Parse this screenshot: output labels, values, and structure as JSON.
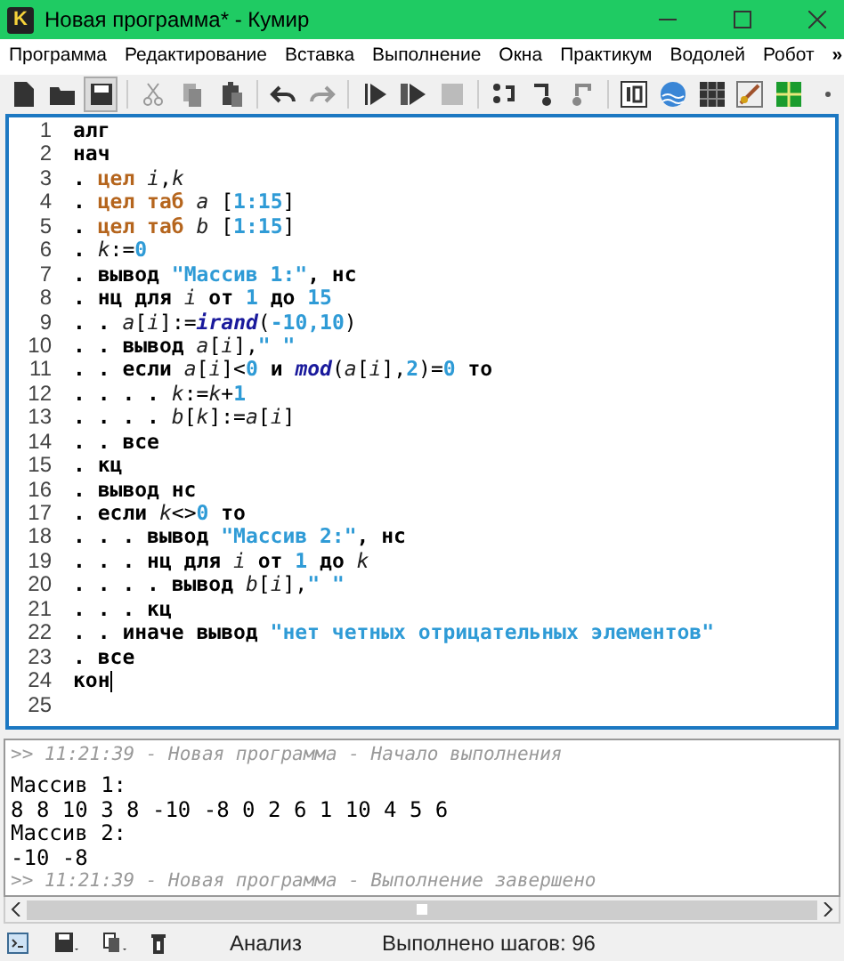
{
  "window": {
    "logo": "K",
    "title": "Новая программа* - Кумир"
  },
  "menu": [
    "Программа",
    "Редактирование",
    "Вставка",
    "Выполнение",
    "Окна",
    "Практикум",
    "Водолей",
    "Робот"
  ],
  "menu_overflow": "»",
  "editor": {
    "lines": [
      {
        "number": "1",
        "tokens": [
          {
            "kind": "kw",
            "text": "алг"
          }
        ]
      },
      {
        "number": "2",
        "tokens": [
          {
            "kind": "kw",
            "text": "нач"
          }
        ]
      },
      {
        "number": "3",
        "tokens": [
          {
            "kind": "kw",
            "text": ". "
          },
          {
            "kind": "type",
            "text": "цел "
          },
          {
            "kind": "var",
            "text": "i"
          },
          {
            "kind": "op",
            "text": ","
          },
          {
            "kind": "var",
            "text": "k"
          }
        ]
      },
      {
        "number": "4",
        "tokens": [
          {
            "kind": "kw",
            "text": ". "
          },
          {
            "kind": "type",
            "text": "цел таб "
          },
          {
            "kind": "var",
            "text": "a"
          },
          {
            "kind": "op",
            "text": " ["
          },
          {
            "kind": "num",
            "text": "1:15"
          },
          {
            "kind": "op",
            "text": "]"
          }
        ]
      },
      {
        "number": "5",
        "tokens": [
          {
            "kind": "kw",
            "text": ". "
          },
          {
            "kind": "type",
            "text": "цел таб "
          },
          {
            "kind": "var",
            "text": "b"
          },
          {
            "kind": "op",
            "text": " ["
          },
          {
            "kind": "num",
            "text": "1:15"
          },
          {
            "kind": "op",
            "text": "]"
          }
        ]
      },
      {
        "number": "6",
        "tokens": [
          {
            "kind": "kw",
            "text": ". "
          },
          {
            "kind": "var",
            "text": "k"
          },
          {
            "kind": "op",
            "text": ":="
          },
          {
            "kind": "num",
            "text": "0"
          }
        ]
      },
      {
        "number": "7",
        "tokens": [
          {
            "kind": "kw",
            "text": ". вывод "
          },
          {
            "kind": "str",
            "text": "\"Массив 1:\""
          },
          {
            "kind": "kw",
            "text": ", нс"
          }
        ]
      },
      {
        "number": "8",
        "tokens": [
          {
            "kind": "kw",
            "text": ". нц для "
          },
          {
            "kind": "var",
            "text": "i"
          },
          {
            "kind": "kw",
            "text": " от "
          },
          {
            "kind": "num",
            "text": "1"
          },
          {
            "kind": "kw",
            "text": " до "
          },
          {
            "kind": "num",
            "text": "15"
          }
        ]
      },
      {
        "number": "9",
        "tokens": [
          {
            "kind": "kw",
            "text": ". . "
          },
          {
            "kind": "var",
            "text": "a"
          },
          {
            "kind": "op",
            "text": "["
          },
          {
            "kind": "var",
            "text": "i"
          },
          {
            "kind": "op",
            "text": "]:="
          },
          {
            "kind": "func",
            "text": "irand"
          },
          {
            "kind": "op",
            "text": "("
          },
          {
            "kind": "num",
            "text": "-10,10"
          },
          {
            "kind": "op",
            "text": ")"
          }
        ]
      },
      {
        "number": "10",
        "tokens": [
          {
            "kind": "kw",
            "text": ". . вывод "
          },
          {
            "kind": "var",
            "text": "a"
          },
          {
            "kind": "op",
            "text": "["
          },
          {
            "kind": "var",
            "text": "i"
          },
          {
            "kind": "op",
            "text": "],"
          },
          {
            "kind": "str",
            "text": "\" \""
          }
        ]
      },
      {
        "number": "11",
        "tokens": [
          {
            "kind": "kw",
            "text": ". . если "
          },
          {
            "kind": "var",
            "text": "a"
          },
          {
            "kind": "op",
            "text": "["
          },
          {
            "kind": "var",
            "text": "i"
          },
          {
            "kind": "op",
            "text": "]<"
          },
          {
            "kind": "num",
            "text": "0"
          },
          {
            "kind": "kw",
            "text": " и "
          },
          {
            "kind": "func",
            "text": "mod"
          },
          {
            "kind": "op",
            "text": "("
          },
          {
            "kind": "var",
            "text": "a"
          },
          {
            "kind": "op",
            "text": "["
          },
          {
            "kind": "var",
            "text": "i"
          },
          {
            "kind": "op",
            "text": "],"
          },
          {
            "kind": "num",
            "text": "2"
          },
          {
            "kind": "op",
            "text": ")="
          },
          {
            "kind": "num",
            "text": "0"
          },
          {
            "kind": "kw",
            "text": " то"
          }
        ]
      },
      {
        "number": "12",
        "tokens": [
          {
            "kind": "kw",
            "text": ". . . . "
          },
          {
            "kind": "var",
            "text": "k"
          },
          {
            "kind": "op",
            "text": ":="
          },
          {
            "kind": "var",
            "text": "k"
          },
          {
            "kind": "op",
            "text": "+"
          },
          {
            "kind": "num",
            "text": "1"
          }
        ]
      },
      {
        "number": "13",
        "tokens": [
          {
            "kind": "kw",
            "text": ". . . . "
          },
          {
            "kind": "var",
            "text": "b"
          },
          {
            "kind": "op",
            "text": "["
          },
          {
            "kind": "var",
            "text": "k"
          },
          {
            "kind": "op",
            "text": "]:="
          },
          {
            "kind": "var",
            "text": "a"
          },
          {
            "kind": "op",
            "text": "["
          },
          {
            "kind": "var",
            "text": "i"
          },
          {
            "kind": "op",
            "text": "]"
          }
        ]
      },
      {
        "number": "14",
        "tokens": [
          {
            "kind": "kw",
            "text": ". . все"
          }
        ]
      },
      {
        "number": "15",
        "tokens": [
          {
            "kind": "kw",
            "text": ". кц"
          }
        ]
      },
      {
        "number": "16",
        "tokens": [
          {
            "kind": "kw",
            "text": ". вывод нс"
          }
        ]
      },
      {
        "number": "17",
        "tokens": [
          {
            "kind": "kw",
            "text": ". если "
          },
          {
            "kind": "var",
            "text": "k"
          },
          {
            "kind": "op",
            "text": "<>"
          },
          {
            "kind": "num",
            "text": "0"
          },
          {
            "kind": "kw",
            "text": " то"
          }
        ]
      },
      {
        "number": "18",
        "tokens": [
          {
            "kind": "kw",
            "text": ". . . вывод "
          },
          {
            "kind": "str",
            "text": "\"Массив 2:\""
          },
          {
            "kind": "kw",
            "text": ", нс"
          }
        ]
      },
      {
        "number": "19",
        "tokens": [
          {
            "kind": "kw",
            "text": ". . . нц для "
          },
          {
            "kind": "var",
            "text": "i"
          },
          {
            "kind": "kw",
            "text": " от "
          },
          {
            "kind": "num",
            "text": "1"
          },
          {
            "kind": "kw",
            "text": " до "
          },
          {
            "kind": "var",
            "text": "k"
          }
        ]
      },
      {
        "number": "20",
        "tokens": [
          {
            "kind": "kw",
            "text": ". . . . вывод "
          },
          {
            "kind": "var",
            "text": "b"
          },
          {
            "kind": "op",
            "text": "["
          },
          {
            "kind": "var",
            "text": "i"
          },
          {
            "kind": "op",
            "text": "],"
          },
          {
            "kind": "str",
            "text": "\" \""
          }
        ]
      },
      {
        "number": "21",
        "tokens": [
          {
            "kind": "kw",
            "text": ". . . кц"
          }
        ]
      },
      {
        "number": "22",
        "tokens": [
          {
            "kind": "kw",
            "text": ". . иначе вывод "
          },
          {
            "kind": "str",
            "text": "\"нет четных отрицательных элементов\""
          }
        ]
      },
      {
        "number": "23",
        "tokens": [
          {
            "kind": "kw",
            "text": ". все"
          }
        ]
      },
      {
        "number": "24",
        "tokens": [
          {
            "kind": "kw",
            "text": "кон"
          }
        ],
        "cursor": true
      },
      {
        "number": "25"
      }
    ]
  },
  "output": [
    {
      "kind": "log",
      "text": ">> 11:21:39 - Новая программа - Начало выполнения"
    },
    {
      "kind": "out",
      "text": "Массив 1:"
    },
    {
      "kind": "out",
      "text": "8 8 10 3 8 -10 -8 0 2 6 1 10 4 5 6"
    },
    {
      "kind": "out",
      "text": "Массив 2:"
    },
    {
      "kind": "out",
      "text": "-10 -8"
    },
    {
      "kind": "log",
      "text": ">> 11:21:39 - Новая программа - Выполнение завершено"
    }
  ],
  "status_bar": {
    "mode": "Анализ",
    "steps": "Выполнено шагов: 96"
  }
}
